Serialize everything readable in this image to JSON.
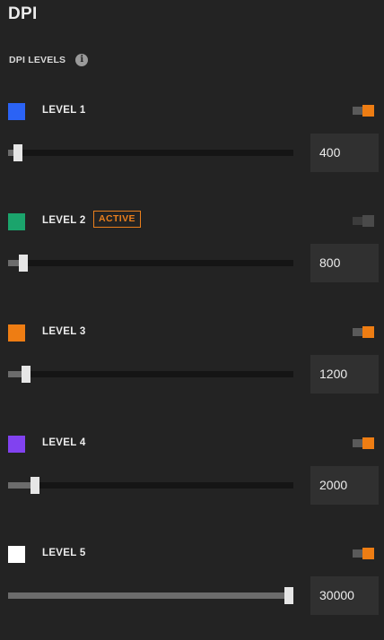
{
  "title": "DPI",
  "section_label": "DPI LEVELS",
  "info_icon": "info-icon",
  "levels": [
    {
      "label": "LEVEL 1",
      "color": "#2b63f5",
      "enabled": true,
      "active": false,
      "value": "400",
      "slider_fraction": 0.02
    },
    {
      "label": "LEVEL 2",
      "color": "#1ba46c",
      "enabled": false,
      "active": true,
      "active_label": "ACTIVE",
      "value": "800",
      "slider_fraction": 0.04
    },
    {
      "label": "LEVEL 3",
      "color": "#ee7d13",
      "enabled": true,
      "active": false,
      "value": "1200",
      "slider_fraction": 0.05
    },
    {
      "label": "LEVEL 4",
      "color": "#8142f0",
      "enabled": true,
      "active": false,
      "value": "2000",
      "slider_fraction": 0.08
    },
    {
      "label": "LEVEL 5",
      "color": "#ffffff",
      "enabled": true,
      "active": false,
      "value": "30000",
      "slider_fraction": 1.0
    }
  ]
}
